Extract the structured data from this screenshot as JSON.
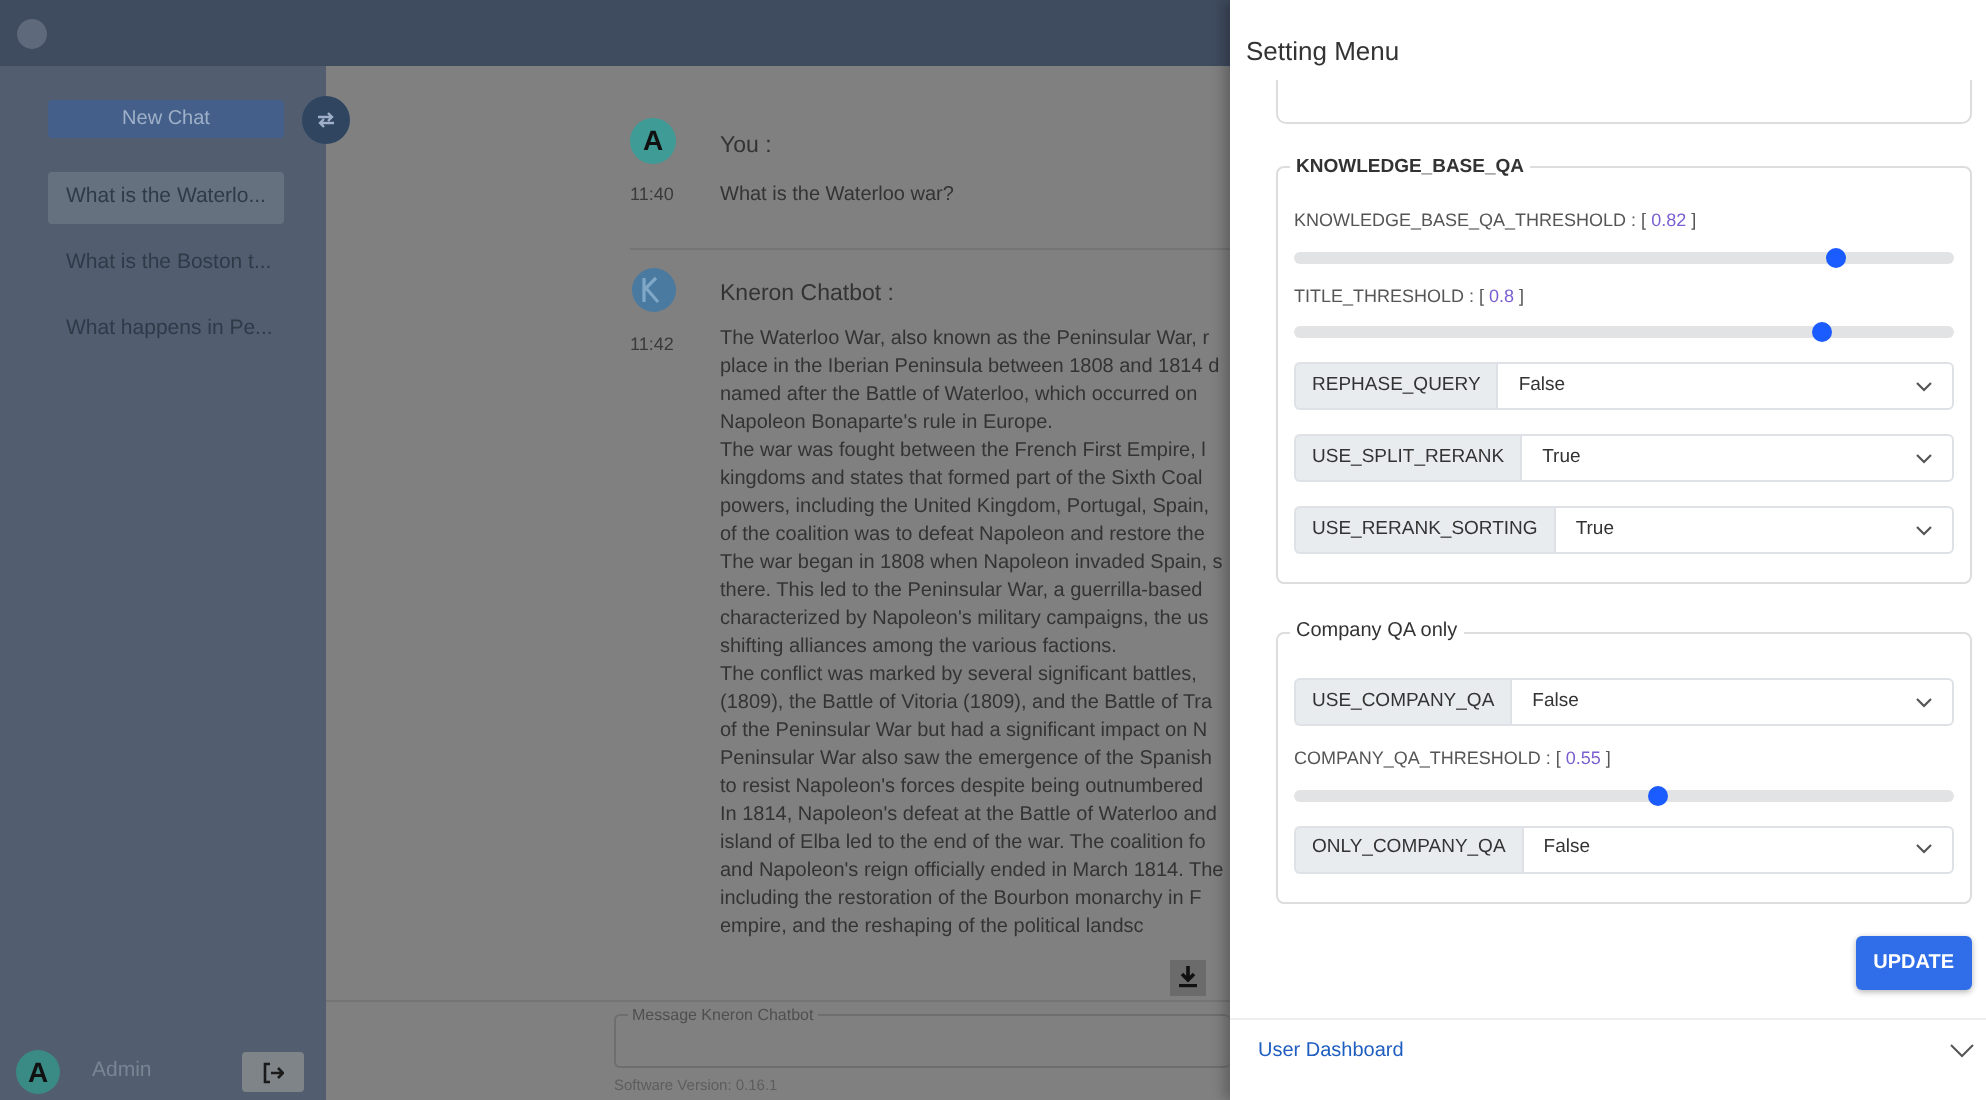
{
  "sidebar": {
    "new_chat_button": "New Chat",
    "chats": [
      {
        "title": "What is the Waterlo...",
        "selected": true
      },
      {
        "title": "What is the Boston t...",
        "selected": false
      },
      {
        "title": "What happens in Pe...",
        "selected": false
      }
    ],
    "user": {
      "avatar": "A",
      "name": "Admin"
    }
  },
  "chat": {
    "messages": [
      {
        "kind": "user",
        "avatar": "A",
        "sender": "You :",
        "time": "11:40",
        "lines": [
          "What is the Waterloo war?"
        ]
      },
      {
        "kind": "bot",
        "sender": "Kneron Chatbot :",
        "time": "11:42",
        "lines": [
          "The Waterloo War, also known as the Peninsular War, r",
          "place in the Iberian Peninsula between 1808 and 1814 d",
          "named after the Battle of Waterloo, which occurred on",
          "Napoleon Bonaparte's rule in Europe.",
          "The war was fought between the French First Empire, l",
          "kingdoms and states that formed part of the Sixth Coal",
          "powers, including the United Kingdom, Portugal, Spain,",
          "of the coalition was to defeat Napoleon and restore the",
          "The war began in 1808 when Napoleon invaded Spain, s",
          "there. This led to the Peninsular War, a guerrilla-based",
          "characterized by Napoleon's military campaigns, the us",
          "shifting alliances among the various factions.",
          "The conflict was marked by several significant battles,",
          "(1809), the Battle of Vitoria (1809), and the Battle of Tra",
          "of the Peninsular War but had a significant impact on N",
          "Peninsular War also saw the emergence of the Spanish",
          "to resist Napoleon's forces despite being outnumbered",
          "In 1814, Napoleon's defeat at the Battle of Waterloo and",
          "island of Elba led to the end of the war. The coalition fo",
          "and Napoleon's reign officially ended in March 1814. The",
          "including the restoration of the Bourbon monarchy in F",
          "empire, and the reshaping of the political landsc"
        ]
      }
    ],
    "message_field": {
      "label": "Message Kneron Chatbot"
    },
    "version": "Software Version: 0.16.1"
  },
  "settings": {
    "title": "Setting Menu",
    "groups": [
      {
        "title": "KNOWLEDGE_BASE_QA",
        "controls": [
          {
            "kind": "slider",
            "prefix": "KNOWLEDGE_BASE_QA_THRESHOLD : [",
            "value": "0.82",
            "suffix": "]",
            "level": 0.82
          },
          {
            "kind": "slider",
            "prefix": "TITLE_THRESHOLD : [",
            "value": "0.8",
            "suffix": "]",
            "level": 0.8
          },
          {
            "kind": "select",
            "label": "REPHASE_QUERY",
            "value": "False"
          },
          {
            "kind": "select",
            "label": "USE_SPLIT_RERANK",
            "value": "True"
          },
          {
            "kind": "select",
            "label": "USE_RERANK_SORTING",
            "value": "True"
          }
        ]
      },
      {
        "title": "Company QA only",
        "controls": [
          {
            "kind": "select",
            "label": "USE_COMPANY_QA",
            "value": "False"
          },
          {
            "kind": "slider",
            "prefix": "COMPANY_QA_THRESHOLD : [",
            "value": "0.55",
            "suffix": "]",
            "level": 0.55
          },
          {
            "kind": "select",
            "label": "ONLY_COMPANY_QA",
            "value": "False"
          }
        ]
      }
    ],
    "update_button": "UPDATE",
    "user_dashboard": {
      "label": "User Dashboard",
      "expanded": false
    }
  }
}
